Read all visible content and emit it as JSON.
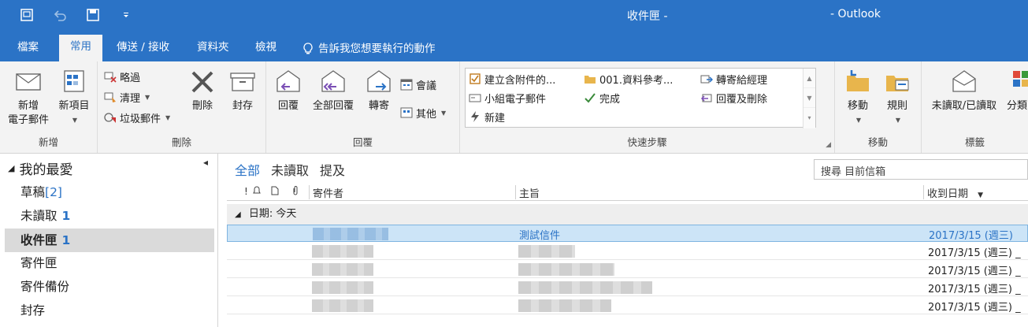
{
  "window": {
    "title_folder": "收件匣 -",
    "title_app": "- Outlook"
  },
  "tabs": [
    {
      "label": "檔案"
    },
    {
      "label": "常用"
    },
    {
      "label": "傳送 / 接收"
    },
    {
      "label": "資料夾"
    },
    {
      "label": "檢視"
    },
    {
      "label": "告訴我您想要執行的動作"
    }
  ],
  "ribbon": {
    "new_group": {
      "label": "新增",
      "new_email_1": "新增",
      "new_email_2": "電子郵件",
      "new_items": "新項目"
    },
    "delete_group": {
      "label": "刪除",
      "ignore": "略過",
      "cleanup": "清理",
      "junk": "垃圾郵件",
      "delete": "刪除",
      "archive": "封存"
    },
    "respond_group": {
      "label": "回覆",
      "reply": "回覆",
      "reply_all": "全部回覆",
      "forward": "轉寄",
      "meeting": "會議",
      "more": "其他"
    },
    "quicksteps_group": {
      "label": "快速步驟",
      "items": [
        "建立含附件的...",
        "001.資料參考...",
        "轉寄給經理",
        "小組電子郵件",
        "完成",
        "回覆及刪除",
        "新建"
      ]
    },
    "move_group": {
      "label": "移動",
      "move": "移動",
      "rules": "規則"
    },
    "tags_group": {
      "label": "標籤",
      "unread_read": "未讀取/已讀取",
      "categorize": "分類"
    }
  },
  "nav": {
    "favorites": "我的最愛",
    "items": [
      {
        "name": "草稿",
        "count": "[2]"
      },
      {
        "name": "未讀取",
        "count": "1"
      },
      {
        "name": "收件匣",
        "count": "1"
      },
      {
        "name": "寄件匣",
        "count": ""
      },
      {
        "name": "寄件備份",
        "count": ""
      },
      {
        "name": "封存",
        "count": ""
      }
    ]
  },
  "list": {
    "filters": [
      "全部",
      "未讀取",
      "提及"
    ],
    "search_placeholder": "搜尋 目前信箱",
    "columns": {
      "from": "寄件者",
      "subject": "主旨",
      "received": "收到日期"
    },
    "group_header": "日期: 今天",
    "rows": [
      {
        "subject": "測試信件",
        "date": "2017/3/15 (週三)"
      },
      {
        "subject": "",
        "date": "2017/3/15 (週三) _"
      },
      {
        "subject": "",
        "date": "2017/3/15 (週三) _"
      },
      {
        "subject": "",
        "date": "2017/3/15 (週三) _"
      },
      {
        "subject": "",
        "date": "2017/3/15 (週三) _"
      }
    ]
  },
  "colors": {
    "accent": "#2b73c6",
    "ribbon_bg": "#f3f3f3",
    "selected_row": "#cce4f7"
  }
}
